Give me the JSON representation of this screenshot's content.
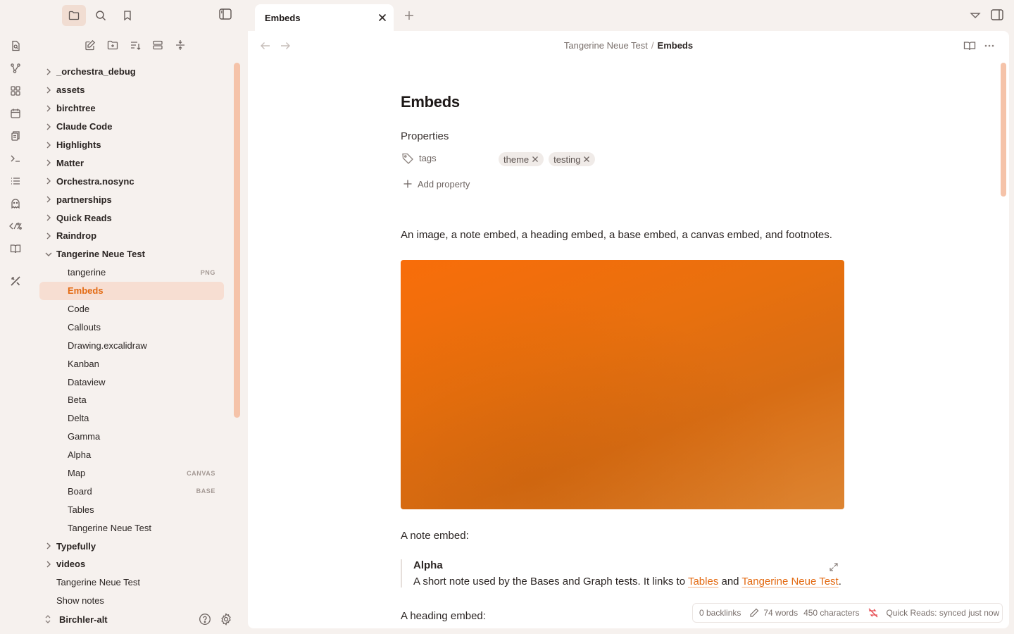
{
  "sidebar_top": {
    "icons": [
      "folder-icon",
      "search-icon",
      "bookmark-icon"
    ],
    "toggle": "sidebar-toggle-icon"
  },
  "ribbon": {
    "icons": [
      "search-file-icon",
      "graph-icon",
      "grid-icon",
      "calendar-icon",
      "copy-icon",
      "terminal-icon",
      "list-icon",
      "ghost-icon",
      "template-icon",
      "book-icon",
      "tools-icon"
    ]
  },
  "file_toolbar": {
    "icons": [
      "new-note-icon",
      "new-folder-icon",
      "sort-icon",
      "collapse-icon",
      "expand-collapse-icon"
    ]
  },
  "tree": {
    "folders_top": [
      {
        "label": "_orchestra_debug"
      },
      {
        "label": "assets"
      },
      {
        "label": "birchtree"
      },
      {
        "label": "Claude Code"
      },
      {
        "label": "Highlights"
      },
      {
        "label": "Matter"
      },
      {
        "label": "Orchestra.nosync"
      },
      {
        "label": "partnerships"
      },
      {
        "label": "Quick Reads"
      },
      {
        "label": "Raindrop"
      }
    ],
    "open_folder": {
      "label": "Tangerine Neue Test"
    },
    "children": [
      {
        "label": "tangerine",
        "badge": "PNG"
      },
      {
        "label": "Embeds",
        "badge": ""
      },
      {
        "label": "Code",
        "badge": ""
      },
      {
        "label": "Callouts",
        "badge": ""
      },
      {
        "label": "Drawing.excalidraw",
        "badge": ""
      },
      {
        "label": "Kanban",
        "badge": ""
      },
      {
        "label": "Dataview",
        "badge": ""
      },
      {
        "label": "Beta",
        "badge": ""
      },
      {
        "label": "Delta",
        "badge": ""
      },
      {
        "label": "Gamma",
        "badge": ""
      },
      {
        "label": "Alpha",
        "badge": ""
      },
      {
        "label": "Map",
        "badge": "CANVAS"
      },
      {
        "label": "Board",
        "badge": "BASE"
      },
      {
        "label": "Tables",
        "badge": ""
      },
      {
        "label": "Tangerine Neue Test",
        "badge": ""
      }
    ],
    "folders_bottom": [
      {
        "label": "Typefully"
      },
      {
        "label": "videos"
      }
    ],
    "root_files": [
      {
        "label": "Tangerine Neue Test"
      },
      {
        "label": "Show notes"
      }
    ],
    "selected": "Embeds"
  },
  "vault": {
    "name": "Birchler-alt"
  },
  "tab": {
    "title": "Embeds"
  },
  "breadcrumb": {
    "parent": "Tangerine Neue Test",
    "separator": "/",
    "current": "Embeds"
  },
  "doc": {
    "title": "Embeds",
    "properties_heading": "Properties",
    "property_key": "tags",
    "tags": [
      "theme",
      "testing"
    ],
    "add_property": "Add property",
    "intro": "An image, a note embed, a heading embed, a base embed, a canvas embed, and footnotes.",
    "note_embed_label": "A note embed:",
    "embed": {
      "title": "Alpha",
      "text_before": "A short note used by the Bases and Graph tests. It links to ",
      "link1": "Tables",
      "text_mid": " and ",
      "link2": "Tangerine Neue Test",
      "text_after": "."
    },
    "heading_embed_label": "A heading embed:"
  },
  "status": {
    "backlinks": "0 backlinks",
    "words": "74 words",
    "characters": "450 characters",
    "sync": "Quick Reads: synced just now"
  },
  "colors": {
    "accent": "#e36a12",
    "selected_bg": "#f7ded2",
    "scrollbar": "#f5c3a9",
    "sync_error": "#e5484d"
  }
}
